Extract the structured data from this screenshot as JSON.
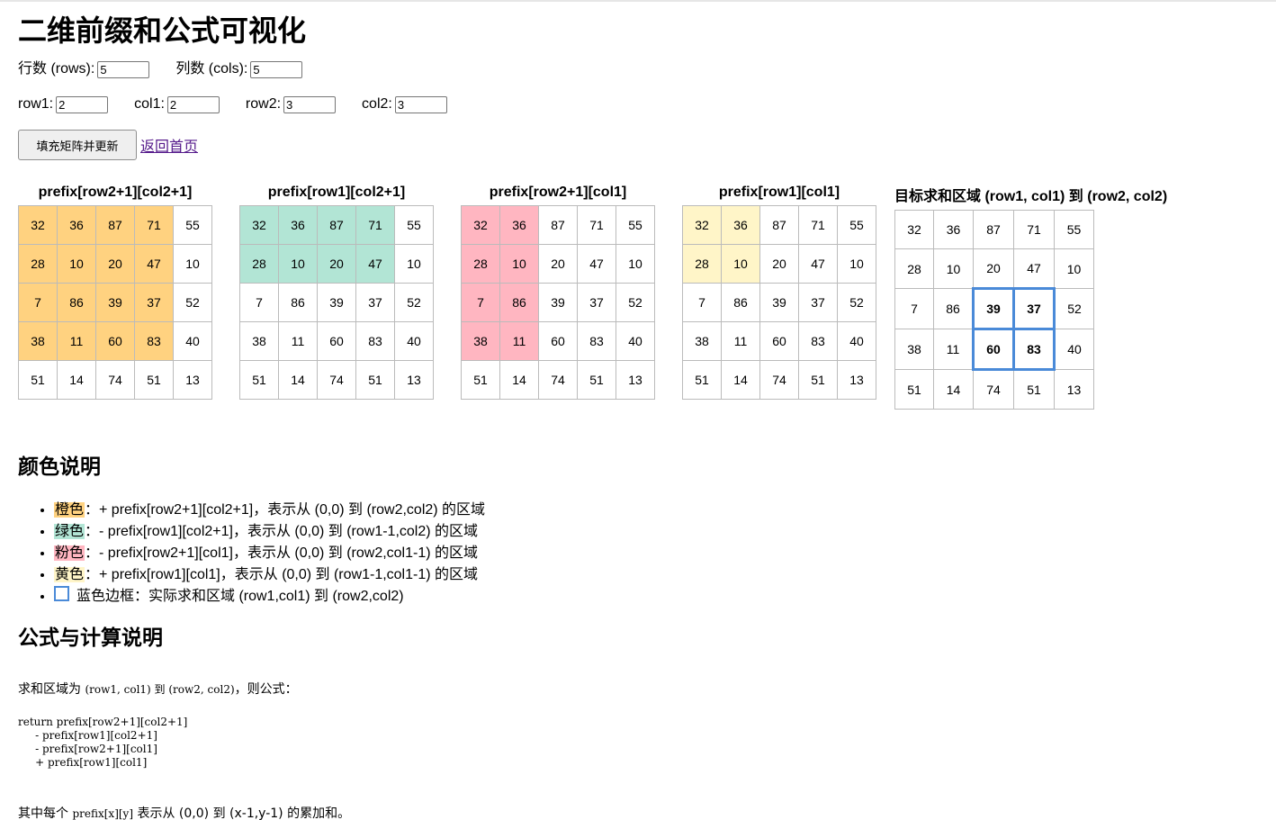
{
  "title": "二维前缀和公式可视化",
  "controls": {
    "rows_label": "行数 (rows):",
    "rows_value": "5",
    "cols_label": "列数 (cols):",
    "cols_value": "5",
    "row1_label": "row1:",
    "row1_value": "2",
    "col1_label": "col1:",
    "col1_value": "2",
    "row2_label": "row2:",
    "row2_value": "3",
    "col2_label": "col2:",
    "col2_value": "3"
  },
  "actions": {
    "fill_button": "填充矩阵并更新",
    "back_link": "返回首页"
  },
  "matrix": [
    [
      32,
      36,
      87,
      71,
      55
    ],
    [
      28,
      10,
      20,
      47,
      10
    ],
    [
      7,
      86,
      39,
      37,
      52
    ],
    [
      38,
      11,
      60,
      83,
      40
    ],
    [
      51,
      14,
      74,
      51,
      13
    ]
  ],
  "panels": [
    {
      "title": "prefix[row2+1][col2+1]",
      "color": "#ffd280",
      "rows": 4,
      "cols": 4
    },
    {
      "title": "prefix[row1][col2+1]",
      "color": "#b2e5d5",
      "rows": 2,
      "cols": 4
    },
    {
      "title": "prefix[row2+1][col1]",
      "color": "#ffb6c1",
      "rows": 4,
      "cols": 2
    },
    {
      "title": "prefix[row1][col1]",
      "color": "#fff5c8",
      "rows": 2,
      "cols": 2
    }
  ],
  "target": {
    "title": "目标求和区域 (row1, col1) 到 (row2, col2)",
    "row1": 2,
    "col1": 2,
    "row2": 3,
    "col2": 3,
    "border_color": "#4a8ad8"
  },
  "legend": {
    "heading": "颜色说明",
    "items": [
      {
        "tag": "橙色",
        "color": "#ffd280",
        "text": "：+ prefix[row2+1][col2+1]，表示从 (0,0) 到 (row2,col2) 的区域"
      },
      {
        "tag": "绿色",
        "color": "#b2e5d5",
        "text": "：- prefix[row1][col2+1]，表示从 (0,0) 到 (row1-1,col2) 的区域"
      },
      {
        "tag": "粉色",
        "color": "#ffb6c1",
        "text": "：- prefix[row2+1][col1]，表示从 (0,0) 到 (row2,col1-1) 的区域"
      },
      {
        "tag": "黄色",
        "color": "#fff5c8",
        "text": "：+ prefix[row1][col1]，表示从 (0,0) 到 (row1-1,col1-1) 的区域"
      }
    ],
    "box_item": "蓝色边框：实际求和区域 (row1,col1) 到 (row2,col2)"
  },
  "formula": {
    "heading": "公式与计算说明",
    "intro_prefix": "求和区域为 ",
    "intro_code": "(row1, col1) 到 (row2, col2)",
    "intro_suffix": "，则公式：",
    "code": "return prefix[row2+1][col2+1]\n     - prefix[row1][col2+1]\n     - prefix[row2+1][col1]\n     + prefix[row1][col1]",
    "footer_prefix": "其中每个 ",
    "footer_code": "prefix[x][y]",
    "footer_suffix": " 表示从 (0,0) 到 (x-1,y-1) 的累加和。"
  }
}
